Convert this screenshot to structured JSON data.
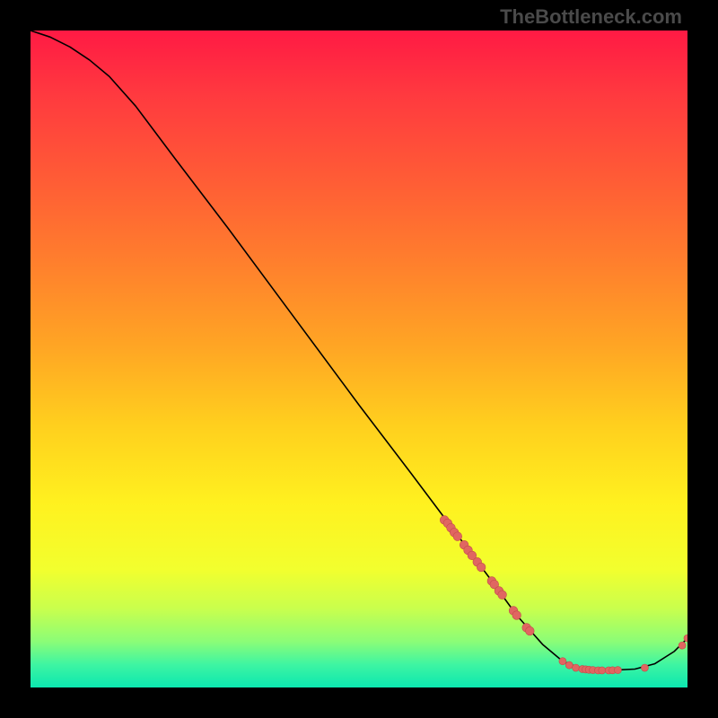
{
  "watermark": "TheBottleneck.com",
  "colors": {
    "marker_fill": "#e06661",
    "marker_stroke": "#c24e49",
    "curve": "#000000"
  },
  "gradient_stops": [
    {
      "offset": 0.0,
      "color": "#ff1a44"
    },
    {
      "offset": 0.1,
      "color": "#ff3a3f"
    },
    {
      "offset": 0.22,
      "color": "#ff5a36"
    },
    {
      "offset": 0.35,
      "color": "#ff7e2d"
    },
    {
      "offset": 0.48,
      "color": "#ffa524"
    },
    {
      "offset": 0.6,
      "color": "#ffcf1e"
    },
    {
      "offset": 0.72,
      "color": "#fff11f"
    },
    {
      "offset": 0.82,
      "color": "#f2ff2e"
    },
    {
      "offset": 0.88,
      "color": "#c9ff4d"
    },
    {
      "offset": 0.93,
      "color": "#8bfd77"
    },
    {
      "offset": 0.965,
      "color": "#3ef5a2"
    },
    {
      "offset": 1.0,
      "color": "#0ce7b0"
    }
  ],
  "chart_data": {
    "type": "line",
    "title": "",
    "xlabel": "",
    "ylabel": "",
    "xlim": [
      0,
      100
    ],
    "ylim": [
      0,
      100
    ],
    "grid": false,
    "curve": [
      {
        "x": 0.0,
        "y": 100.0
      },
      {
        "x": 3.0,
        "y": 99.0
      },
      {
        "x": 6.0,
        "y": 97.5
      },
      {
        "x": 9.0,
        "y": 95.5
      },
      {
        "x": 12.0,
        "y": 93.0
      },
      {
        "x": 16.0,
        "y": 88.5
      },
      {
        "x": 22.0,
        "y": 80.5
      },
      {
        "x": 30.0,
        "y": 70.0
      },
      {
        "x": 40.0,
        "y": 56.5
      },
      {
        "x": 50.0,
        "y": 43.0
      },
      {
        "x": 58.0,
        "y": 32.5
      },
      {
        "x": 64.0,
        "y": 24.5
      },
      {
        "x": 70.0,
        "y": 16.5
      },
      {
        "x": 74.0,
        "y": 11.0
      },
      {
        "x": 78.0,
        "y": 6.5
      },
      {
        "x": 81.0,
        "y": 4.0
      },
      {
        "x": 84.0,
        "y": 2.8
      },
      {
        "x": 88.0,
        "y": 2.6
      },
      {
        "x": 92.0,
        "y": 2.8
      },
      {
        "x": 95.0,
        "y": 3.6
      },
      {
        "x": 98.0,
        "y": 5.5
      },
      {
        "x": 100.0,
        "y": 7.5
      }
    ],
    "markers": [
      {
        "x": 63.0,
        "y": 25.5,
        "r": 1.2
      },
      {
        "x": 63.5,
        "y": 25.0,
        "r": 1.2
      },
      {
        "x": 64.0,
        "y": 24.3,
        "r": 1.2
      },
      {
        "x": 64.5,
        "y": 23.6,
        "r": 1.2
      },
      {
        "x": 65.0,
        "y": 23.0,
        "r": 1.2
      },
      {
        "x": 66.0,
        "y": 21.7,
        "r": 1.2
      },
      {
        "x": 66.6,
        "y": 20.9,
        "r": 1.2
      },
      {
        "x": 67.2,
        "y": 20.1,
        "r": 1.2
      },
      {
        "x": 68.0,
        "y": 19.1,
        "r": 1.2
      },
      {
        "x": 68.6,
        "y": 18.3,
        "r": 1.2
      },
      {
        "x": 70.2,
        "y": 16.2,
        "r": 1.2
      },
      {
        "x": 70.6,
        "y": 15.7,
        "r": 1.2
      },
      {
        "x": 71.3,
        "y": 14.7,
        "r": 1.2
      },
      {
        "x": 71.8,
        "y": 14.1,
        "r": 1.2
      },
      {
        "x": 73.5,
        "y": 11.7,
        "r": 1.2
      },
      {
        "x": 74.0,
        "y": 11.0,
        "r": 1.2
      },
      {
        "x": 75.5,
        "y": 9.1,
        "r": 1.2
      },
      {
        "x": 76.0,
        "y": 8.6,
        "r": 1.2
      },
      {
        "x": 81.0,
        "y": 4.0,
        "r": 1.0
      },
      {
        "x": 82.0,
        "y": 3.4,
        "r": 1.0
      },
      {
        "x": 83.0,
        "y": 3.0,
        "r": 1.0
      },
      {
        "x": 84.0,
        "y": 2.8,
        "r": 1.0
      },
      {
        "x": 84.5,
        "y": 2.75,
        "r": 1.0
      },
      {
        "x": 85.0,
        "y": 2.7,
        "r": 1.0
      },
      {
        "x": 85.6,
        "y": 2.65,
        "r": 1.0
      },
      {
        "x": 86.4,
        "y": 2.6,
        "r": 1.0
      },
      {
        "x": 87.0,
        "y": 2.6,
        "r": 1.0
      },
      {
        "x": 88.0,
        "y": 2.6,
        "r": 1.0
      },
      {
        "x": 88.6,
        "y": 2.62,
        "r": 1.0
      },
      {
        "x": 89.4,
        "y": 2.65,
        "r": 1.0
      },
      {
        "x": 93.5,
        "y": 3.0,
        "r": 1.0
      },
      {
        "x": 99.2,
        "y": 6.4,
        "r": 1.0
      },
      {
        "x": 100.0,
        "y": 7.5,
        "r": 1.0
      }
    ]
  }
}
